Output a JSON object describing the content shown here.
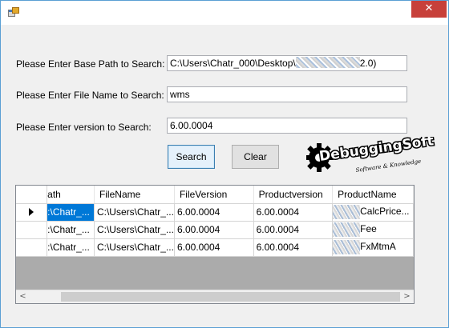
{
  "window": {
    "icon": "winforms-app-icon",
    "close_glyph": "✕"
  },
  "form": {
    "base_path_label": "Please Enter Base Path to Search:",
    "base_path_value_start": "C:\\Users\\Chatr_000\\Desktop\\",
    "base_path_value_end": "2.0)",
    "file_name_label": "Please Enter File Name to Search:",
    "file_name_value": "wms",
    "version_label": "Please Enter version to Search:",
    "version_value": "6.00.0004",
    "search_label": "Search",
    "clear_label": "Clear"
  },
  "logo": {
    "text": "DebuggingSoft",
    "tagline": "Software & Knowledge"
  },
  "grid": {
    "columns": [
      "Path",
      "FileName",
      "FileVersion",
      "Productversion",
      "ProductName"
    ],
    "visible_columns": [
      "ath",
      "FileName",
      "FileVersion",
      "Productversion",
      "ProductName"
    ],
    "rows": [
      {
        "path": ":\\Chatr_...",
        "filename": "C:\\Users\\Chatr_...",
        "fileversion": "6.00.0004",
        "productversion": "6.00.0004",
        "productname": "CalcPrice...",
        "selected": true
      },
      {
        "path": ":\\Chatr_...",
        "filename": "C:\\Users\\Chatr_...",
        "fileversion": "6.00.0004",
        "productversion": "6.00.0004",
        "productname": "Fee",
        "selected": false
      },
      {
        "path": ":\\Chatr_...",
        "filename": "C:\\Users\\Chatr_...",
        "fileversion": "6.00.0004",
        "productversion": "6.00.0004",
        "productname": "FxMtmA",
        "selected": false
      }
    ],
    "current_row_glyph": "▶"
  },
  "scrollbar": {
    "left_glyph": "<",
    "right_glyph": ">"
  },
  "colors": {
    "selection": "#0078d7",
    "close_button": "#c7403a",
    "window_border": "#5a9fd4",
    "grid_background": "#ababab"
  }
}
